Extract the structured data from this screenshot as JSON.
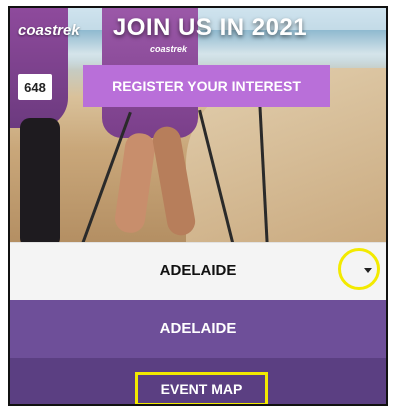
{
  "hero": {
    "title": "JOIN US IN 2021",
    "register_label": "REGISTER YOUR INTEREST",
    "brand_text": "coastrek",
    "brand_small": "coastrek",
    "bib_number": "648"
  },
  "location_select": {
    "selected_value": "ADELAIDE",
    "options": [
      {
        "label": "ADELAIDE"
      },
      {
        "label": "EVENT MAP"
      }
    ]
  },
  "colors": {
    "register_button": "#b96fd9",
    "option_primary": "#6e4f99",
    "option_secondary": "#5b3f82",
    "annotation": "#f3ea00"
  }
}
